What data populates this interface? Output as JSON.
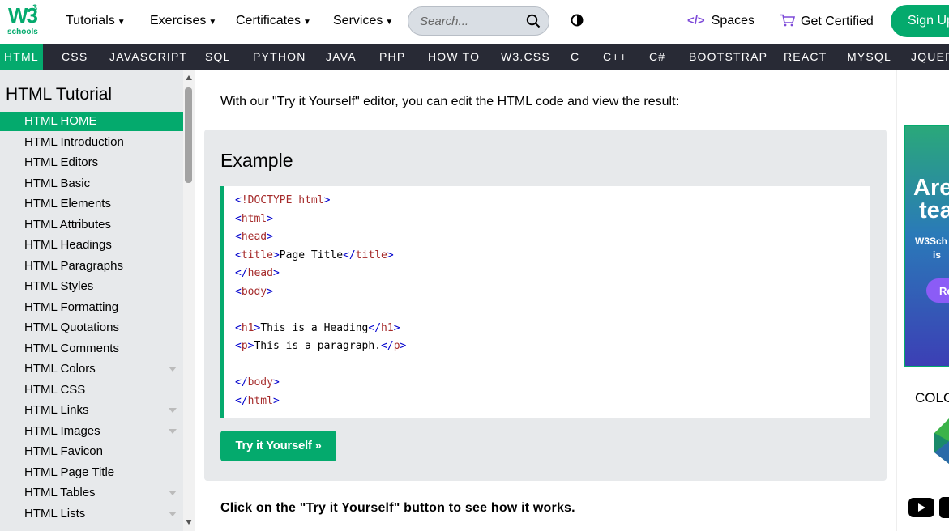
{
  "colors": {
    "brand": "#04AA6D",
    "langbar": "#282A35",
    "sidebar_bg": "#E7E9EB"
  },
  "header": {
    "logo_text": "W3",
    "logo_sup": "3",
    "logo_sub": "schools",
    "menus": [
      "Tutorials",
      "Exercises",
      "Certificates",
      "Services"
    ],
    "search_placeholder": "Search...",
    "spaces_label": "Spaces",
    "certified_label": "Get Certified",
    "signup_label": "Sign Up"
  },
  "langbar": [
    "HTML",
    "CSS",
    "JAVASCRIPT",
    "SQL",
    "PYTHON",
    "JAVA",
    "PHP",
    "HOW TO",
    "W3.CSS",
    "C",
    "C++",
    "C#",
    "BOOTSTRAP",
    "REACT",
    "MYSQL",
    "JQUERY"
  ],
  "sidebar": {
    "title": "HTML Tutorial",
    "items": [
      {
        "label": "HTML HOME",
        "active": true,
        "dropdown": false
      },
      {
        "label": "HTML Introduction",
        "active": false,
        "dropdown": false
      },
      {
        "label": "HTML Editors",
        "active": false,
        "dropdown": false
      },
      {
        "label": "HTML Basic",
        "active": false,
        "dropdown": false
      },
      {
        "label": "HTML Elements",
        "active": false,
        "dropdown": false
      },
      {
        "label": "HTML Attributes",
        "active": false,
        "dropdown": false
      },
      {
        "label": "HTML Headings",
        "active": false,
        "dropdown": false
      },
      {
        "label": "HTML Paragraphs",
        "active": false,
        "dropdown": false
      },
      {
        "label": "HTML Styles",
        "active": false,
        "dropdown": false
      },
      {
        "label": "HTML Formatting",
        "active": false,
        "dropdown": false
      },
      {
        "label": "HTML Quotations",
        "active": false,
        "dropdown": false
      },
      {
        "label": "HTML Comments",
        "active": false,
        "dropdown": false
      },
      {
        "label": "HTML Colors",
        "active": false,
        "dropdown": true
      },
      {
        "label": "HTML CSS",
        "active": false,
        "dropdown": false
      },
      {
        "label": "HTML Links",
        "active": false,
        "dropdown": true
      },
      {
        "label": "HTML Images",
        "active": false,
        "dropdown": true
      },
      {
        "label": "HTML Favicon",
        "active": false,
        "dropdown": false
      },
      {
        "label": "HTML Page Title",
        "active": false,
        "dropdown": false
      },
      {
        "label": "HTML Tables",
        "active": false,
        "dropdown": true
      },
      {
        "label": "HTML Lists",
        "active": false,
        "dropdown": true
      }
    ]
  },
  "main": {
    "intro": "With our \"Try it Yourself\" editor, you can edit the HTML code and view the result:",
    "example_title": "Example",
    "code_lines": [
      "<!DOCTYPE html>",
      "<html>",
      "<head>",
      "<title>Page Title</title>",
      "</head>",
      "<body>",
      "",
      "<h1>This is a Heading</h1>",
      "<p>This is a paragraph.</p>",
      "",
      "</body>",
      "</html>"
    ],
    "tryit_label": "Try it Yourself »",
    "click_note": "Click on the \"Try it Yourself\" button to see how it works."
  },
  "rightcol": {
    "ad_headline_1": "Are",
    "ad_headline_2": "tea",
    "ad_sub_1": "W3Sch",
    "ad_sub_2": "is",
    "ad_button": "Re",
    "color_label": "COLO"
  }
}
